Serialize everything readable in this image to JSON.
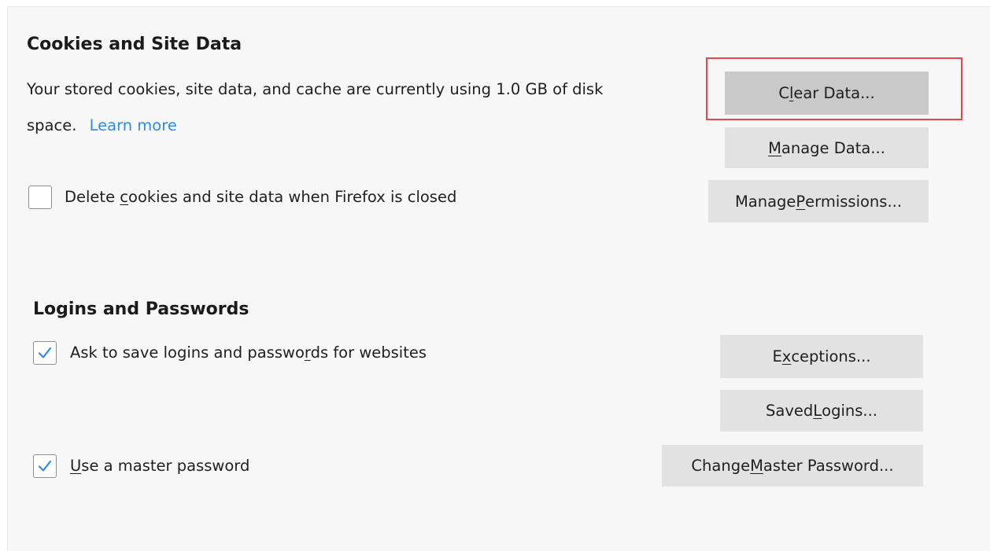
{
  "cookies": {
    "heading": "Cookies and Site Data",
    "description_line1": "Your stored cookies, site data, and cache are currently using 1.0 GB of disk",
    "description_line2": "space.",
    "learn_more": "Learn more",
    "clear_data_button": {
      "pre": "C",
      "accel": "l",
      "post": "ear Data..."
    },
    "manage_data_button": {
      "pre": "",
      "accel": "M",
      "post": "anage Data..."
    },
    "manage_permissions_button": {
      "pre": "Manage ",
      "accel": "P",
      "post": "ermissions..."
    },
    "delete_on_close": {
      "checked": false,
      "label": {
        "pre": "Delete ",
        "accel": "c",
        "post": "ookies and site data when Firefox is closed"
      }
    }
  },
  "logins": {
    "heading": "Logins and Passwords",
    "ask_to_save": {
      "checked": true,
      "label": {
        "pre": "Ask to save logins and passwo",
        "accel": "r",
        "post": "ds for websites"
      }
    },
    "exceptions_button": {
      "pre": "E",
      "accel": "x",
      "post": "ceptions..."
    },
    "saved_logins_button": {
      "pre": "Saved ",
      "accel": "L",
      "post": "ogins..."
    },
    "master_password": {
      "checked": true,
      "label": {
        "pre": "",
        "accel": "U",
        "post": "se a master password"
      }
    },
    "change_master_button": {
      "pre": "Change ",
      "accel": "M",
      "post": "aster Password..."
    }
  },
  "colors": {
    "link": "#2f8ae8",
    "highlight_border": "#e5484d",
    "checkmark": "#2f8ae8",
    "button_bg": "#e2e2e2",
    "button_pressed_bg": "#c9c9c9",
    "panel_bg": "#f7f7f7"
  },
  "annotation": {
    "highlighted_element": "clear-data-button"
  }
}
